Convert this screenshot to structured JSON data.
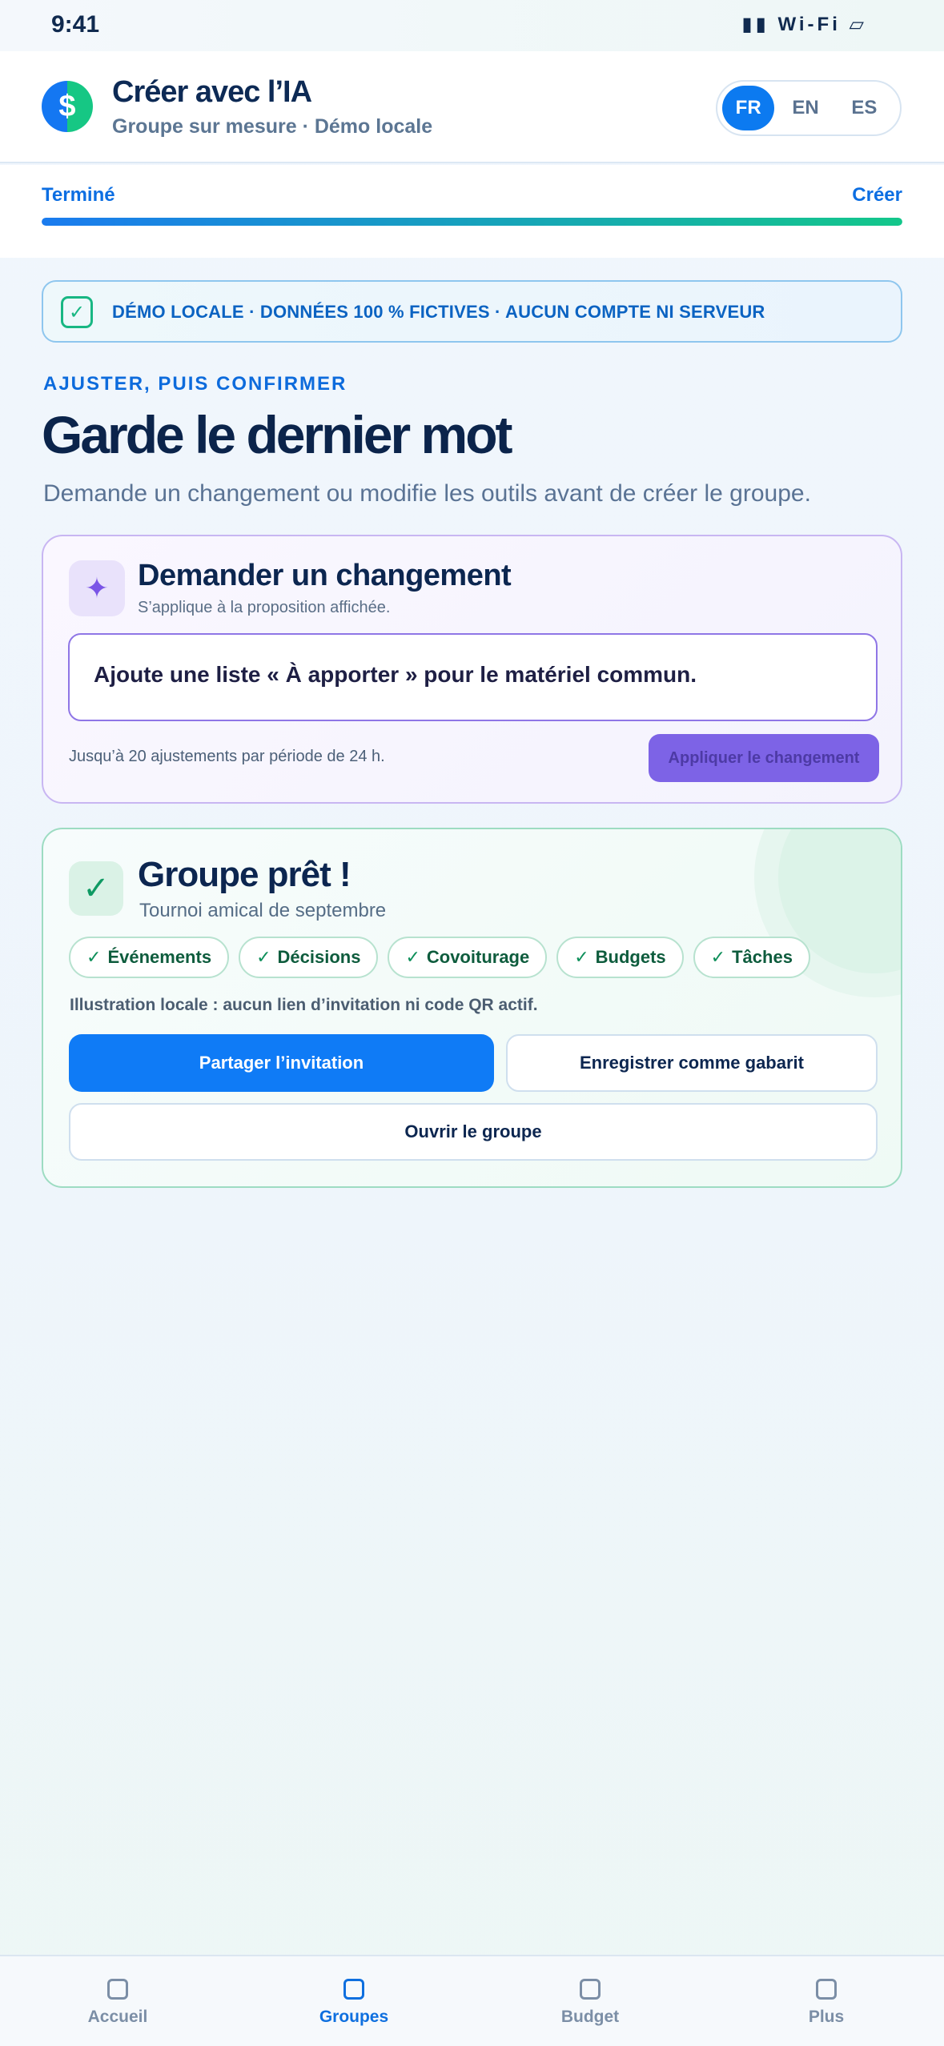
{
  "status": {
    "time": "9:41",
    "signal": "▮▮ Wi-Fi ▱"
  },
  "header": {
    "logo_glyph": "$",
    "title": "Créer avec l’IA",
    "subtitle": "Groupe sur mesure · Démo locale",
    "languages": [
      "FR",
      "EN",
      "ES"
    ],
    "active_language": "FR"
  },
  "progress": {
    "left_label": "Terminé",
    "right_label": "Créer",
    "fraction": 1.0
  },
  "banner": {
    "text": "DÉMO LOCALE · DONNÉES 100 % FICTIVES · AUCUN COMPTE NI SERVEUR"
  },
  "intro": {
    "eyebrow": "AJUSTER, PUIS CONFIRMER",
    "title": "Garde le dernier mot",
    "lead": "Demande un changement ou modifie les outils avant de créer le groupe."
  },
  "change_card": {
    "title": "Demander un changement",
    "subtitle": "S’applique à la proposition affichée.",
    "input_value": "Ajoute une liste « À apporter » pour le matériel commun.",
    "limit_note": "Jusqu’à 20 ajustements par période de 24 h.",
    "apply_label": "Appliquer le changement"
  },
  "ready_card": {
    "title": "Groupe prêt !",
    "subtitle": "Tournoi amical de septembre",
    "tools": [
      "Événements",
      "Décisions",
      "Covoiturage",
      "Budgets",
      "Tâches"
    ],
    "info": "Illustration locale : aucun lien d’invitation ni code QR actif.",
    "share_label": "Partager l’invitation",
    "template_label": "Enregistrer comme gabarit",
    "open_label": "Ouvrir le groupe"
  },
  "tabbar": {
    "items": [
      "Accueil",
      "Groupes",
      "Budget",
      "Plus"
    ],
    "active": "Groupes"
  },
  "colors": {
    "accent": "#0f7bf6",
    "success": "#13c78a",
    "purple": "#7d63e6"
  }
}
